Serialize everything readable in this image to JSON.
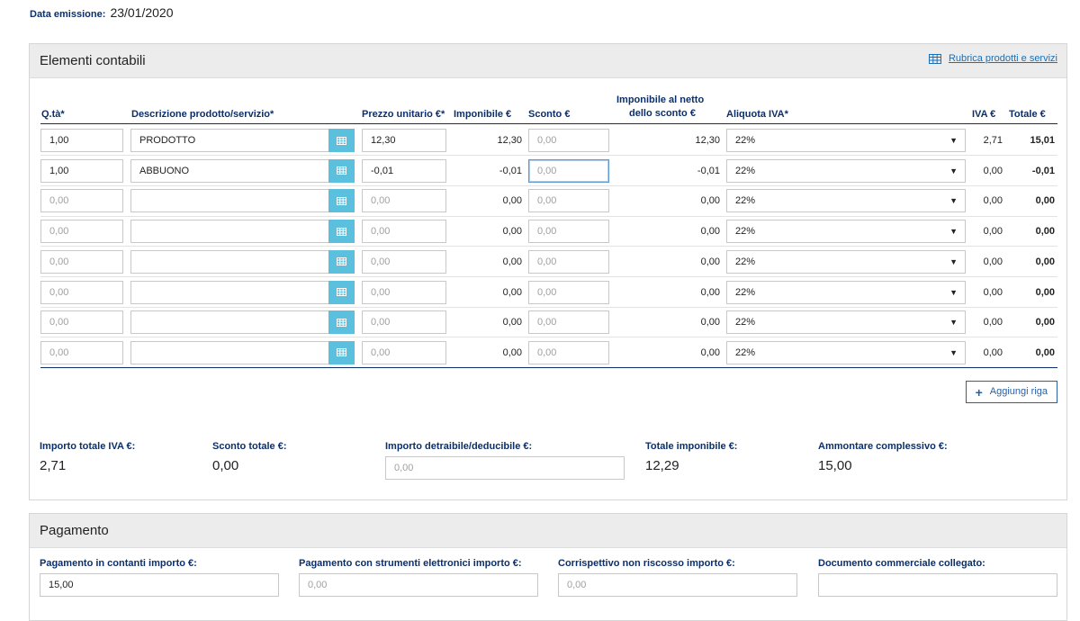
{
  "header": {
    "date_label": "Data emissione:",
    "date_value": "23/01/2020"
  },
  "elementi": {
    "title": "Elementi contabili",
    "rubrica_label": "Rubrica prodotti e servizi",
    "columns": {
      "qta": "Q.tà*",
      "descrizione": "Descrizione prodotto/servizio*",
      "prezzo": "Prezzo unitario €*",
      "imponibile": "Imponibile €",
      "sconto": "Sconto €",
      "imponibile_netto_1": "Imponibile al netto",
      "imponibile_netto_2": "dello sconto €",
      "aliquota": "Aliquota IVA*",
      "iva": "IVA €",
      "totale": "Totale €"
    },
    "rows": [
      {
        "qta": "1,00",
        "descrizione": "PRODOTTO",
        "prezzo": "12,30",
        "imponibile": "12,30",
        "sconto": "0,00",
        "netto": "12,30",
        "aliquota": "22%",
        "iva": "2,71",
        "totale": "15,01"
      },
      {
        "qta": "1,00",
        "descrizione": "ABBUONO",
        "prezzo": "-0,01",
        "imponibile": "-0,01",
        "sconto": "0,00",
        "netto": "-0,01",
        "aliquota": "22%",
        "iva": "0,00",
        "totale": "-0,01"
      },
      {
        "qta": "0,00",
        "descrizione": "",
        "prezzo": "0,00",
        "imponibile": "0,00",
        "sconto": "0,00",
        "netto": "0,00",
        "aliquota": "22%",
        "iva": "0,00",
        "totale": "0,00"
      },
      {
        "qta": "0,00",
        "descrizione": "",
        "prezzo": "0,00",
        "imponibile": "0,00",
        "sconto": "0,00",
        "netto": "0,00",
        "aliquota": "22%",
        "iva": "0,00",
        "totale": "0,00"
      },
      {
        "qta": "0,00",
        "descrizione": "",
        "prezzo": "0,00",
        "imponibile": "0,00",
        "sconto": "0,00",
        "netto": "0,00",
        "aliquota": "22%",
        "iva": "0,00",
        "totale": "0,00"
      },
      {
        "qta": "0,00",
        "descrizione": "",
        "prezzo": "0,00",
        "imponibile": "0,00",
        "sconto": "0,00",
        "netto": "0,00",
        "aliquota": "22%",
        "iva": "0,00",
        "totale": "0,00"
      },
      {
        "qta": "0,00",
        "descrizione": "",
        "prezzo": "0,00",
        "imponibile": "0,00",
        "sconto": "0,00",
        "netto": "0,00",
        "aliquota": "22%",
        "iva": "0,00",
        "totale": "0,00"
      },
      {
        "qta": "0,00",
        "descrizione": "",
        "prezzo": "0,00",
        "imponibile": "0,00",
        "sconto": "0,00",
        "netto": "0,00",
        "aliquota": "22%",
        "iva": "0,00",
        "totale": "0,00"
      }
    ],
    "add_row_label": "Aggiungi riga",
    "summary": {
      "importo_iva_label": "Importo totale IVA €:",
      "importo_iva_value": "2,71",
      "sconto_totale_label": "Sconto totale €:",
      "sconto_totale_value": "0,00",
      "detraibile_label": "Importo detraibile/deducibile €:",
      "detraibile_placeholder": "0,00",
      "totale_imponibile_label": "Totale imponibile €:",
      "totale_imponibile_value": "12,29",
      "ammontare_label": "Ammontare complessivo €:",
      "ammontare_value": "15,00"
    }
  },
  "pagamento": {
    "title": "Pagamento",
    "contanti_label": "Pagamento in contanti importo €:",
    "contanti_value": "15,00",
    "elettronici_label": "Pagamento con strumenti elettronici importo €:",
    "elettronici_placeholder": "0,00",
    "non_riscosso_label": "Corrispettivo non riscosso importo €:",
    "non_riscosso_placeholder": "0,00",
    "documento_label": "Documento commerciale collegato:",
    "documento_value": ""
  }
}
